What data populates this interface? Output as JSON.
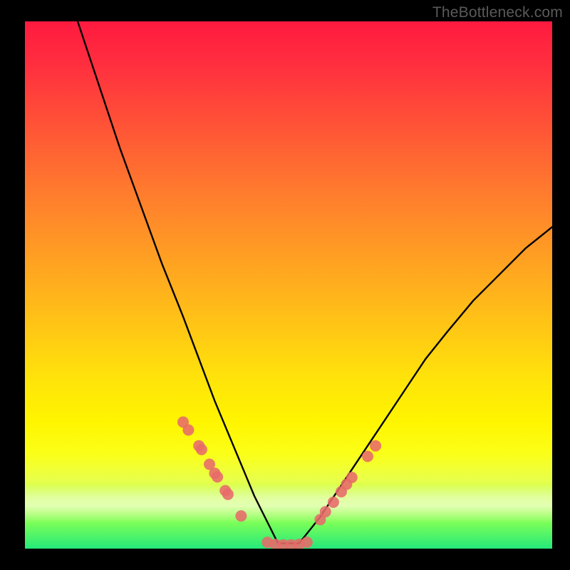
{
  "watermark": "TheBottleneck.com",
  "chart_data": {
    "type": "line",
    "title": "",
    "xlabel": "",
    "ylabel": "",
    "xlim": [
      0,
      100
    ],
    "ylim": [
      0,
      100
    ],
    "grid": false,
    "legend": false,
    "series": [
      {
        "name": "bottleneck-curve",
        "color": "#000000",
        "x": [
          10,
          14,
          18,
          22,
          26,
          30,
          33,
          36,
          38.5,
          41,
          43.5,
          46,
          48,
          52,
          56,
          60,
          64,
          68,
          72,
          76,
          80,
          85,
          90,
          95,
          100
        ],
        "values": [
          100,
          88,
          76,
          65,
          54,
          44,
          36,
          28,
          22,
          16,
          10,
          5,
          1,
          1,
          6,
          12,
          18,
          24,
          30,
          36,
          41,
          47,
          52,
          57,
          61
        ]
      }
    ],
    "markers": [
      {
        "name": "left-cluster",
        "color": "#e76a6a",
        "points_x": [
          30,
          31,
          33,
          33.5,
          35,
          36,
          36.5,
          38,
          38.5,
          41
        ],
        "points_y": [
          24,
          22.5,
          19.5,
          18.8,
          16,
          14.3,
          13.6,
          11,
          10.3,
          6.2
        ]
      },
      {
        "name": "valley-points",
        "color": "#e76a6a",
        "points_x": [
          46,
          47.5,
          49,
          50.5,
          52,
          53.5
        ],
        "points_y": [
          1.2,
          0.8,
          0.7,
          0.7,
          0.8,
          1.2
        ]
      },
      {
        "name": "right-cluster",
        "color": "#e76a6a",
        "points_x": [
          56,
          57,
          58.5,
          60,
          61,
          62,
          65,
          66.5
        ],
        "points_y": [
          5.5,
          7,
          8.8,
          10.8,
          12.2,
          13.5,
          17.5,
          19.5
        ]
      }
    ],
    "colors": {
      "gradient_top": "#ff1a3f",
      "gradient_mid": "#ffe40a",
      "gradient_bottom": "#24e97a",
      "marker": "#e76a6a",
      "curve": "#000000"
    }
  }
}
